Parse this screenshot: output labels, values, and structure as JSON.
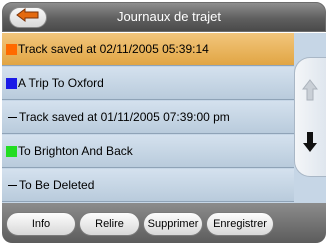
{
  "title": "Journaux de trajet",
  "list": {
    "items": [
      {
        "label": "Track saved at 02/11/2005 05:39:14",
        "color": "#ff6a00",
        "marker": "swatch",
        "selected": true
      },
      {
        "label": "A Trip To Oxford",
        "color": "#1a1ae6",
        "marker": "swatch",
        "selected": false
      },
      {
        "label": "Track saved at 01/11/2005 07:39:00 pm",
        "color": "#000000",
        "marker": "dash",
        "selected": false
      },
      {
        "label": "To Brighton And Back",
        "color": "#22dd22",
        "marker": "swatch",
        "selected": false
      },
      {
        "label": "To Be Deleted",
        "color": "#000000",
        "marker": "dash",
        "selected": false
      }
    ]
  },
  "buttons": {
    "info": "Info",
    "replay": "Relire",
    "delete": "Supprimer",
    "save": "Enregistrer"
  },
  "icons": {
    "back": "back-arrow-icon",
    "scroll_up": "arrow-up-icon",
    "scroll_down": "arrow-down-icon"
  },
  "colors": {
    "selected_row": "#e8b45a",
    "row": "#c6d6e6",
    "title_bar": "#5f5f5f"
  }
}
